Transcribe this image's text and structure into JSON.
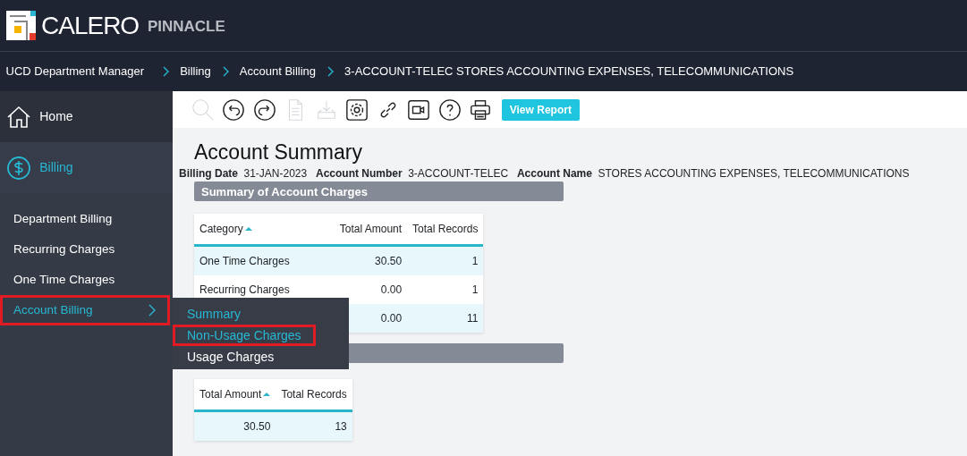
{
  "header": {
    "logo": "CALERO",
    "product": "PINNACLE"
  },
  "breadcrumb": [
    "UCD Department Manager",
    "Billing",
    "Account Billing",
    "3-ACCOUNT-TELEC STORES ACCOUNTING EXPENSES, TELECOMMUNICATIONS"
  ],
  "sidebar": {
    "sections": [
      {
        "label": "Home",
        "kind": "home",
        "selected": false
      },
      {
        "label": "Billing",
        "kind": "billing",
        "selected": true
      }
    ],
    "items": [
      {
        "label": "Department Billing",
        "selected": false,
        "highlighted": false,
        "submenu": false
      },
      {
        "label": "Recurring Charges",
        "selected": false,
        "highlighted": false,
        "submenu": false
      },
      {
        "label": "One Time Charges",
        "selected": false,
        "highlighted": false,
        "submenu": false
      },
      {
        "label": "Account Billing",
        "selected": true,
        "highlighted": true,
        "submenu": true
      }
    ]
  },
  "flyout": [
    {
      "label": "Summary",
      "selected": true,
      "highlighted": false
    },
    {
      "label": "Non-Usage Charges",
      "selected": true,
      "highlighted": true
    },
    {
      "label": "Usage Charges",
      "selected": false,
      "highlighted": false
    }
  ],
  "toolbar": {
    "icons": [
      {
        "kind": "search",
        "disabled": true
      },
      {
        "kind": "undo",
        "disabled": false
      },
      {
        "kind": "redo",
        "disabled": false
      },
      {
        "kind": "document",
        "disabled": true
      },
      {
        "kind": "download",
        "disabled": true
      },
      {
        "kind": "settings",
        "disabled": false
      },
      {
        "kind": "link",
        "disabled": false
      },
      {
        "kind": "video",
        "disabled": false
      },
      {
        "kind": "help",
        "disabled": false
      },
      {
        "kind": "print",
        "disabled": false
      }
    ],
    "button": "View Report"
  },
  "title": "Account Summary",
  "info": [
    {
      "label": "Billing Date",
      "value": "31-JAN-2023"
    },
    {
      "label": "Account Number",
      "value": "3-ACCOUNT-TELEC"
    },
    {
      "label": "Account Name",
      "value": "STORES ACCOUNTING EXPENSES, TELECOMMUNICATIONS"
    }
  ],
  "sections": [
    {
      "title": "Summary of Account Charges",
      "table": {
        "columns": [
          {
            "label": "Category",
            "sorted": true
          },
          {
            "label": "Total Amount",
            "sorted": false
          },
          {
            "label": "Total Records",
            "sorted": false
          }
        ],
        "rows": [
          [
            "One Time Charges",
            "30.50",
            "1"
          ],
          [
            "Recurring Charges",
            "0.00",
            "1"
          ],
          [
            "",
            "0.00",
            "11"
          ]
        ]
      }
    },
    {
      "table": {
        "columns": [
          {
            "label": "Total Amount",
            "sorted": true
          },
          {
            "label": "Total Records",
            "sorted": false
          }
        ],
        "rows": [
          [
            "30.50",
            "13"
          ]
        ]
      }
    }
  ]
}
